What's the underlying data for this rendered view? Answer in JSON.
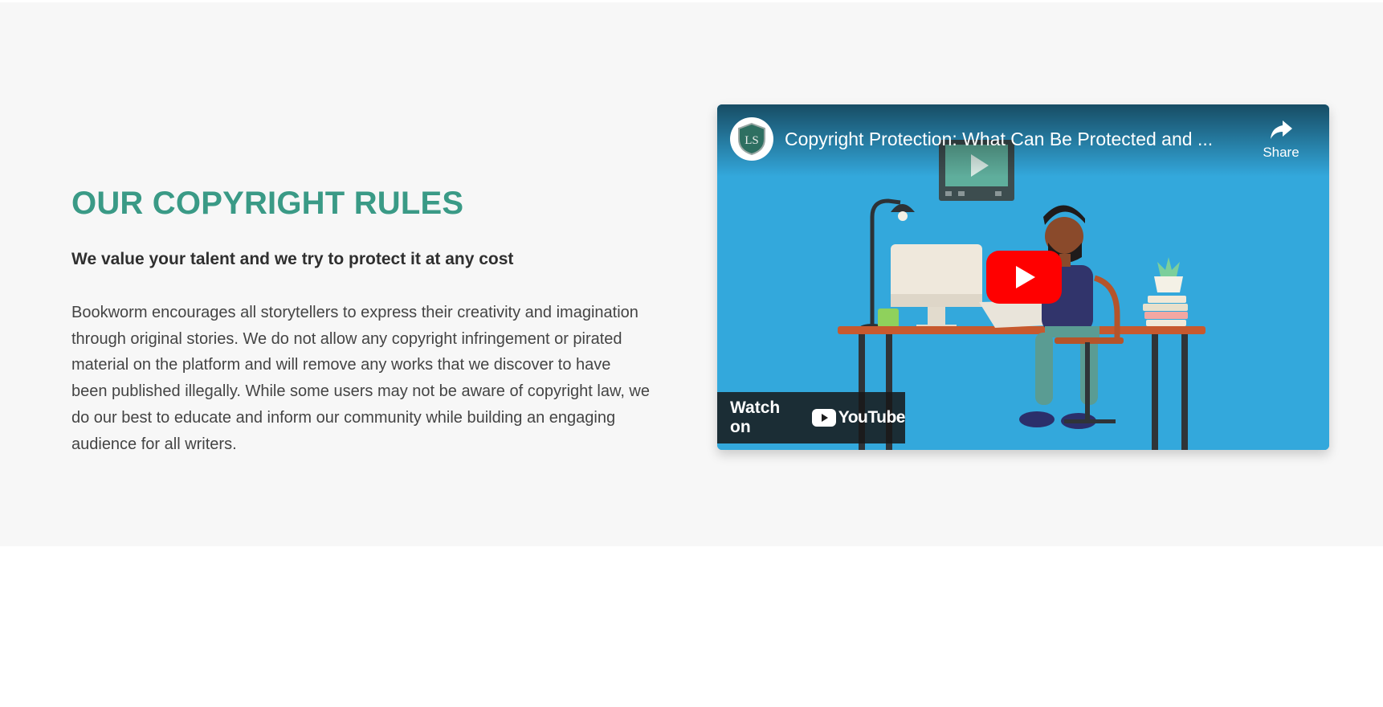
{
  "section": {
    "heading": "OUR COPYRIGHT RULES",
    "subheading": "We value your talent and we try to protect it at any cost",
    "body": "Bookworm encourages all storytellers to express their creativity and imagination through original stories. We do not allow any copyright infringement or pirated material on the platform and will remove any works that we discover to have been published illegally. While some users may not be aware of copyright law, we do our best to educate and inform our community while building an engaging audience for all writers."
  },
  "video": {
    "title": "Copyright Protection: What Can Be Protected and ...",
    "share_label": "Share",
    "watch_on_label": "Watch on",
    "platform_label": "YouTube",
    "channel_logo_letters": "LS",
    "icons": [
      "channel-logo-icon",
      "share-icon",
      "play-icon",
      "youtube-logo-icon"
    ]
  },
  "colors": {
    "heading": "#3a9a86",
    "section_background": "#f7f7f7",
    "video_background": "#33a8dc",
    "play_button": "#ff0000"
  }
}
